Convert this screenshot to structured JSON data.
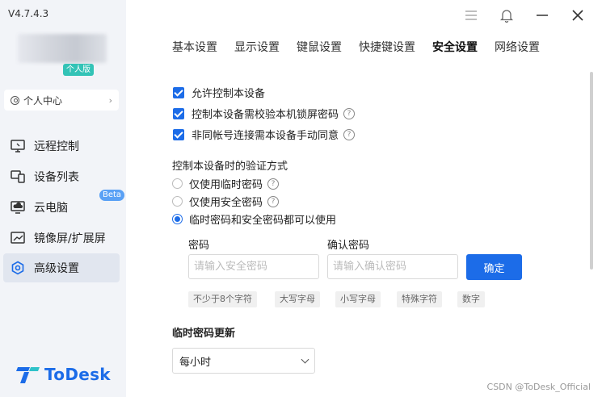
{
  "app": {
    "version": "V4.7.4.3",
    "edition_badge": "个人版",
    "personal_center": "个人中心",
    "logo_text": "ToDesk",
    "brand_color": "#1c6ce8"
  },
  "sidebar": {
    "items": [
      {
        "label": "远程控制",
        "icon": "monitor-icon"
      },
      {
        "label": "设备列表",
        "icon": "devices-icon"
      },
      {
        "label": "云电脑",
        "icon": "cloud-pc-icon",
        "badge": "Beta"
      },
      {
        "label": "镜像屏/扩展屏",
        "icon": "mirror-screen-icon"
      },
      {
        "label": "高级设置",
        "icon": "gear-icon",
        "active": true
      }
    ]
  },
  "tabs": [
    {
      "label": "基本设置"
    },
    {
      "label": "显示设置"
    },
    {
      "label": "键鼠设置"
    },
    {
      "label": "快捷键设置"
    },
    {
      "label": "安全设置",
      "active": true
    },
    {
      "label": "网络设置"
    }
  ],
  "security": {
    "options": [
      {
        "label": "允许控制本设备",
        "checked": true,
        "help": false
      },
      {
        "label": "控制本设备需校验本机锁屏密码",
        "checked": true,
        "help": true
      },
      {
        "label": "非同帐号连接需本设备手动同意",
        "checked": true,
        "help": true
      }
    ],
    "auth_title": "控制本设备时的验证方式",
    "auth_modes": [
      {
        "label": "仅使用临时密码",
        "selected": false,
        "help": true
      },
      {
        "label": "仅使用安全密码",
        "selected": false,
        "help": true
      },
      {
        "label": "临时密码和安全密码都可以使用",
        "selected": true,
        "help": false
      }
    ],
    "password_label": "密码",
    "password_placeholder": "请输入安全密码",
    "confirm_label": "确认密码",
    "confirm_placeholder": "请输入确认密码",
    "confirm_button": "确定",
    "rules": [
      "不少于8个字符",
      "大写字母",
      "小写字母",
      "特殊字符",
      "数字"
    ],
    "temp_update_title": "临时密码更新",
    "temp_update_value": "每小时"
  },
  "watermark": "CSDN @ToDesk_Official"
}
